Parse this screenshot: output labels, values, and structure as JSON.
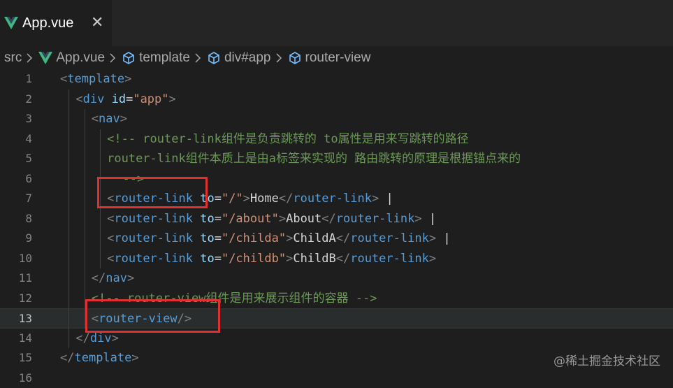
{
  "tab": {
    "title": "App.vue",
    "close_glyph": "✕",
    "icon": "vue-icon"
  },
  "breadcrumb": [
    {
      "label": "src",
      "icon": ""
    },
    {
      "label": "App.vue",
      "icon": "vue-icon"
    },
    {
      "label": "template",
      "icon": "cube-icon"
    },
    {
      "label": "div#app",
      "icon": "cube-icon"
    },
    {
      "label": "router-view",
      "icon": "cube-icon"
    }
  ],
  "editor": {
    "current_line": 13,
    "lines": [
      {
        "num": "1",
        "indent": 0,
        "tokens": [
          [
            "br",
            "<"
          ],
          [
            "tag",
            "template"
          ],
          [
            "br",
            ">"
          ]
        ]
      },
      {
        "num": "2",
        "indent": 1,
        "tokens": [
          [
            "br",
            "<"
          ],
          [
            "tag",
            "div"
          ],
          [
            "txt",
            " "
          ],
          [
            "attr",
            "id"
          ],
          [
            "txt",
            "="
          ],
          [
            "str",
            "\"app\""
          ],
          [
            "br",
            ">"
          ]
        ]
      },
      {
        "num": "3",
        "indent": 2,
        "tokens": [
          [
            "br",
            "<"
          ],
          [
            "tag",
            "nav"
          ],
          [
            "br",
            ">"
          ]
        ]
      },
      {
        "num": "4",
        "indent": 3,
        "tokens": [
          [
            "cmt",
            "<!-- router-link组件是负责跳转的 to属性是用来写跳转的路径"
          ]
        ]
      },
      {
        "num": "5",
        "indent": 3,
        "tokens": [
          [
            "cmt",
            "router-link组件本质上是由a标签来实现的 路由跳转的原理是根据锚点来的"
          ]
        ]
      },
      {
        "num": "6",
        "indent": 4,
        "tokens": [
          [
            "cmt",
            "-->"
          ]
        ]
      },
      {
        "num": "7",
        "indent": 3,
        "tokens": [
          [
            "br",
            "<"
          ],
          [
            "tag",
            "router-link"
          ],
          [
            "txt",
            " "
          ],
          [
            "attr",
            "to"
          ],
          [
            "txt",
            "="
          ],
          [
            "str",
            "\"/\""
          ],
          [
            "br",
            ">"
          ],
          [
            "txt",
            "Home"
          ],
          [
            "br",
            "</"
          ],
          [
            "tag",
            "router-link"
          ],
          [
            "br",
            ">"
          ],
          [
            "txt",
            " |"
          ]
        ]
      },
      {
        "num": "8",
        "indent": 3,
        "tokens": [
          [
            "br",
            "<"
          ],
          [
            "tag",
            "router-link"
          ],
          [
            "txt",
            " "
          ],
          [
            "attr",
            "to"
          ],
          [
            "txt",
            "="
          ],
          [
            "str",
            "\"/about\""
          ],
          [
            "br",
            ">"
          ],
          [
            "txt",
            "About"
          ],
          [
            "br",
            "</"
          ],
          [
            "tag",
            "router-link"
          ],
          [
            "br",
            ">"
          ],
          [
            "txt",
            " |"
          ]
        ]
      },
      {
        "num": "9",
        "indent": 3,
        "tokens": [
          [
            "br",
            "<"
          ],
          [
            "tag",
            "router-link"
          ],
          [
            "txt",
            " "
          ],
          [
            "attr",
            "to"
          ],
          [
            "txt",
            "="
          ],
          [
            "str",
            "\"/childa\""
          ],
          [
            "br",
            ">"
          ],
          [
            "txt",
            "ChildA"
          ],
          [
            "br",
            "</"
          ],
          [
            "tag",
            "router-link"
          ],
          [
            "br",
            ">"
          ],
          [
            "txt",
            " |"
          ]
        ]
      },
      {
        "num": "10",
        "indent": 3,
        "tokens": [
          [
            "br",
            "<"
          ],
          [
            "tag",
            "router-link"
          ],
          [
            "txt",
            " "
          ],
          [
            "attr",
            "to"
          ],
          [
            "txt",
            "="
          ],
          [
            "str",
            "\"/childb\""
          ],
          [
            "br",
            ">"
          ],
          [
            "txt",
            "ChildB"
          ],
          [
            "br",
            "</"
          ],
          [
            "tag",
            "router-link"
          ],
          [
            "br",
            ">"
          ]
        ]
      },
      {
        "num": "11",
        "indent": 2,
        "tokens": [
          [
            "br",
            "</"
          ],
          [
            "tag",
            "nav"
          ],
          [
            "br",
            ">"
          ]
        ]
      },
      {
        "num": "12",
        "indent": 2,
        "tokens": [
          [
            "cmt",
            "<!-- router-view组件是用来展示组件的容器 -->"
          ]
        ]
      },
      {
        "num": "13",
        "indent": 2,
        "tokens": [
          [
            "br",
            "<"
          ],
          [
            "tag",
            "router-view"
          ],
          [
            "br",
            "/>"
          ]
        ]
      },
      {
        "num": "14",
        "indent": 1,
        "tokens": [
          [
            "br",
            "</"
          ],
          [
            "tag",
            "div"
          ],
          [
            "br",
            ">"
          ]
        ]
      },
      {
        "num": "15",
        "indent": 0,
        "tokens": [
          [
            "br",
            "</"
          ],
          [
            "tag",
            "template"
          ],
          [
            "br",
            ">"
          ]
        ]
      },
      {
        "num": "16",
        "indent": 0,
        "tokens": []
      }
    ]
  },
  "watermark": "@稀土掘金技术社区",
  "colors": {
    "background": "#1e1e1e",
    "tag": "#569cd6",
    "attribute": "#9cdcfe",
    "string": "#ce9178",
    "comment": "#6a9955",
    "highlight_box": "#e03030"
  }
}
